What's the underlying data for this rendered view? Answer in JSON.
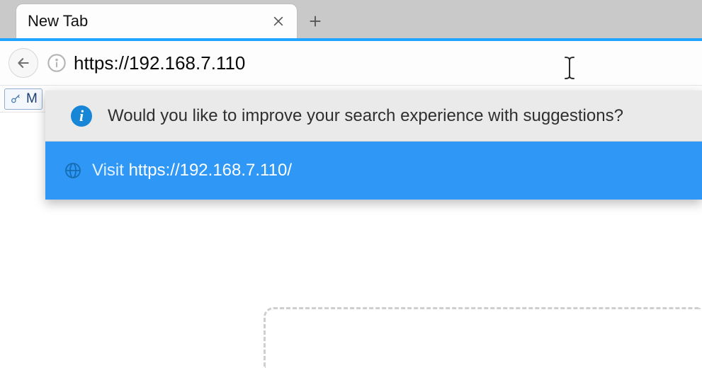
{
  "tab": {
    "title": "New Tab"
  },
  "toolbar": {
    "url": "https://192.168.7.110"
  },
  "bookmarks": {
    "first_label": "M"
  },
  "suggestions": {
    "prompt": "Would you like to improve your search experience with suggestions?",
    "visit_prefix": "Visit ",
    "visit_url": "https://192.168.7.110/"
  }
}
